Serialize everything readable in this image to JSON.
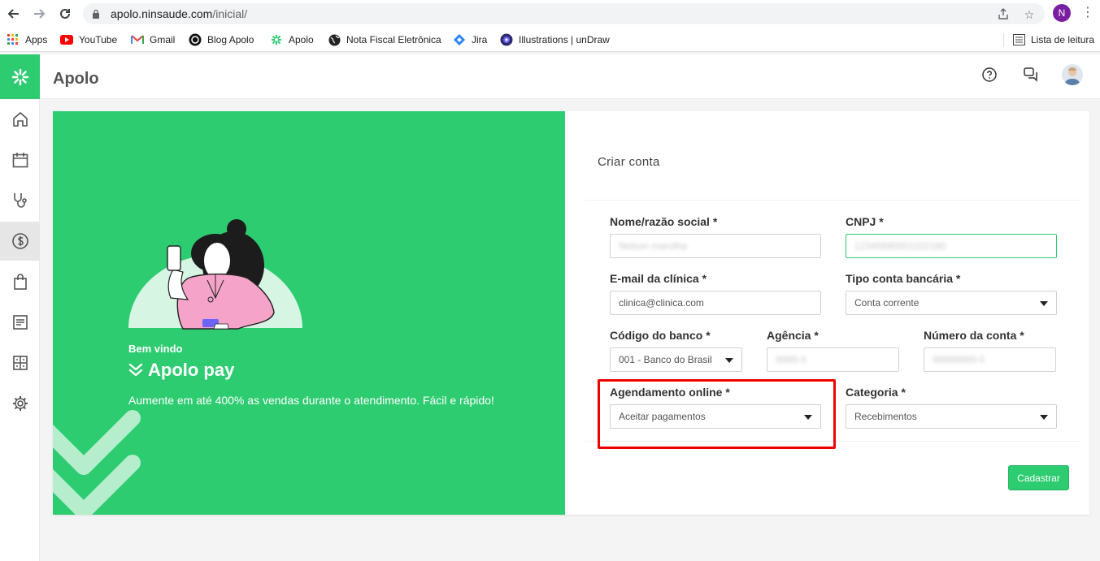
{
  "browser": {
    "url_host": "apolo.ninsaude.com",
    "url_path": "/inicial/",
    "profile_initial": "N"
  },
  "bookmarks": {
    "items": [
      {
        "label": "Apps",
        "icon": "apps-grid-icon"
      },
      {
        "label": "YouTube",
        "icon": "youtube-icon"
      },
      {
        "label": "Gmail",
        "icon": "gmail-icon"
      },
      {
        "label": "Blog Apolo",
        "icon": "blog-icon"
      },
      {
        "label": "Apolo",
        "icon": "apolo-icon"
      },
      {
        "label": "Nota Fiscal Eletrônica",
        "icon": "globe-icon"
      },
      {
        "label": "Jira",
        "icon": "jira-icon"
      },
      {
        "label": "Illustrations | unDraw",
        "icon": "undraw-icon"
      }
    ],
    "reading_list": "Lista de leitura"
  },
  "app": {
    "title": "Apolo",
    "sidebar": [
      "home-icon",
      "calendar-icon",
      "stethoscope-icon",
      "dollar-icon",
      "bag-icon",
      "document-icon",
      "grid-icon",
      "gear-icon"
    ],
    "active_item": "dollar-icon"
  },
  "promo": {
    "welcome": "Bem vindo",
    "brand": "Apolo pay",
    "tagline": "Aumente em até 400% as vendas durante o atendimento. Fácil e rápido!"
  },
  "form": {
    "title": "Criar conta",
    "nome_label": "Nome/razão social *",
    "nome_value": "Nelson marolha",
    "cnpj_label": "CNPJ *",
    "cnpj_value": "12345690001102180",
    "email_label": "E-mail da clínica *",
    "email_value": "clinica@clinica.com",
    "tipo_label": "Tipo conta bancária *",
    "tipo_value": "Conta corrente",
    "banco_label": "Código do banco *",
    "banco_value": "001 - Banco do Brasil",
    "agencia_label": "Agência *",
    "agencia_value": "9999-0",
    "conta_label": "Número da conta *",
    "conta_value": "99999999-0",
    "agendamento_label": "Agendamento online *",
    "agendamento_value": "Aceitar pagamentos",
    "categoria_label": "Categoria *",
    "categoria_value": "Recebimentos",
    "submit_label": "Cadastrar"
  },
  "colors": {
    "brand_green": "#2ecc71",
    "highlight_red": "#e00000",
    "profile_purple": "#7b1fa2"
  }
}
